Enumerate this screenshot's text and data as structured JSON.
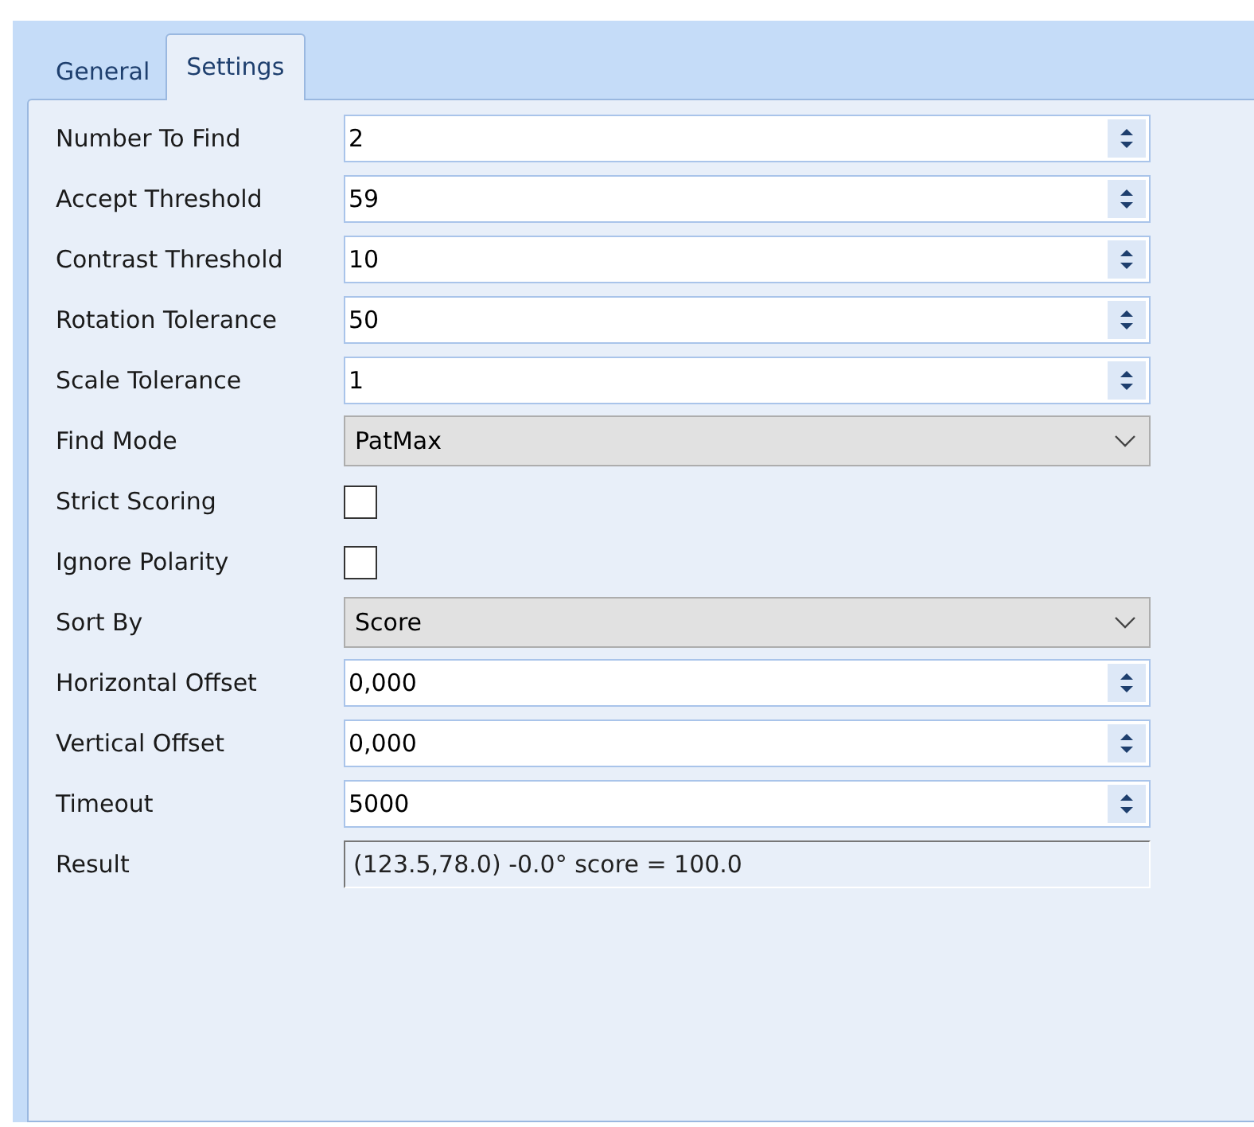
{
  "tabs": [
    {
      "label": "General",
      "selected": false
    },
    {
      "label": "Settings",
      "selected": true
    }
  ],
  "fields": [
    {
      "label": "Number To Find",
      "kind": "spin",
      "value": "2"
    },
    {
      "label": "Accept Threshold",
      "kind": "spin",
      "value": "59"
    },
    {
      "label": "Contrast Threshold",
      "kind": "spin",
      "value": "10"
    },
    {
      "label": "Rotation Tolerance",
      "kind": "spin",
      "value": "50"
    },
    {
      "label": "Scale Tolerance",
      "kind": "spin",
      "value": "1"
    },
    {
      "label": "Find Mode",
      "kind": "dropdown",
      "value": "PatMax"
    },
    {
      "label": "Strict Scoring",
      "kind": "checkbox",
      "checked": false
    },
    {
      "label": "Ignore Polarity",
      "kind": "checkbox",
      "checked": false
    },
    {
      "label": "Sort By",
      "kind": "dropdown",
      "value": "Score"
    },
    {
      "label": "Horizontal Offset",
      "kind": "spin",
      "value": "0,000"
    },
    {
      "label": "Vertical Offset",
      "kind": "spin",
      "value": "0,000"
    },
    {
      "label": "Timeout",
      "kind": "spin",
      "value": "5000"
    },
    {
      "label": "Result",
      "kind": "readonly",
      "value": "(123.5,78.0) -0.0° score = 100.0"
    }
  ]
}
